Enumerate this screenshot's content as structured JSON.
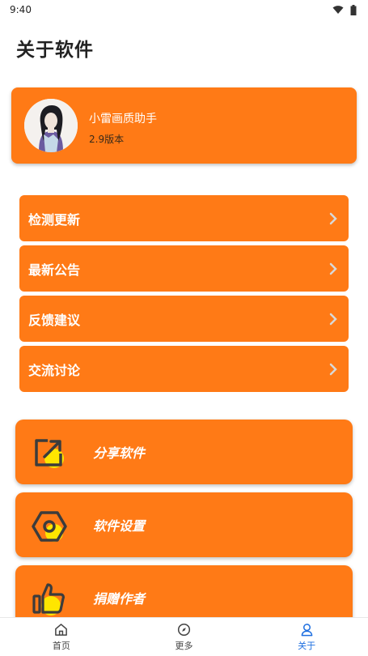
{
  "status_bar": {
    "time": "9:40",
    "icons": [
      "wifi-icon",
      "battery-icon"
    ]
  },
  "page_title": "关于软件",
  "profile": {
    "app_name": "小雷画质助手",
    "version": "2.9版本"
  },
  "menu": [
    {
      "label": "检测更新"
    },
    {
      "label": "最新公告"
    },
    {
      "label": "反馈建议"
    },
    {
      "label": "交流讨论"
    }
  ],
  "actions": [
    {
      "label": "分享软件",
      "icon": "share-edit-icon"
    },
    {
      "label": "软件设置",
      "icon": "hex-nut-settings-icon"
    },
    {
      "label": "捐赠作者",
      "icon": "thumbs-up-icon"
    }
  ],
  "bottom_nav": [
    {
      "label": "首页",
      "icon": "home-icon"
    },
    {
      "label": "更多",
      "icon": "compass-icon"
    },
    {
      "label": "关于",
      "icon": "user-icon"
    }
  ],
  "colors": {
    "accent": "#ff7a16",
    "icon_yellow": "#ffe600",
    "nav_active": "#1e6fe0"
  }
}
